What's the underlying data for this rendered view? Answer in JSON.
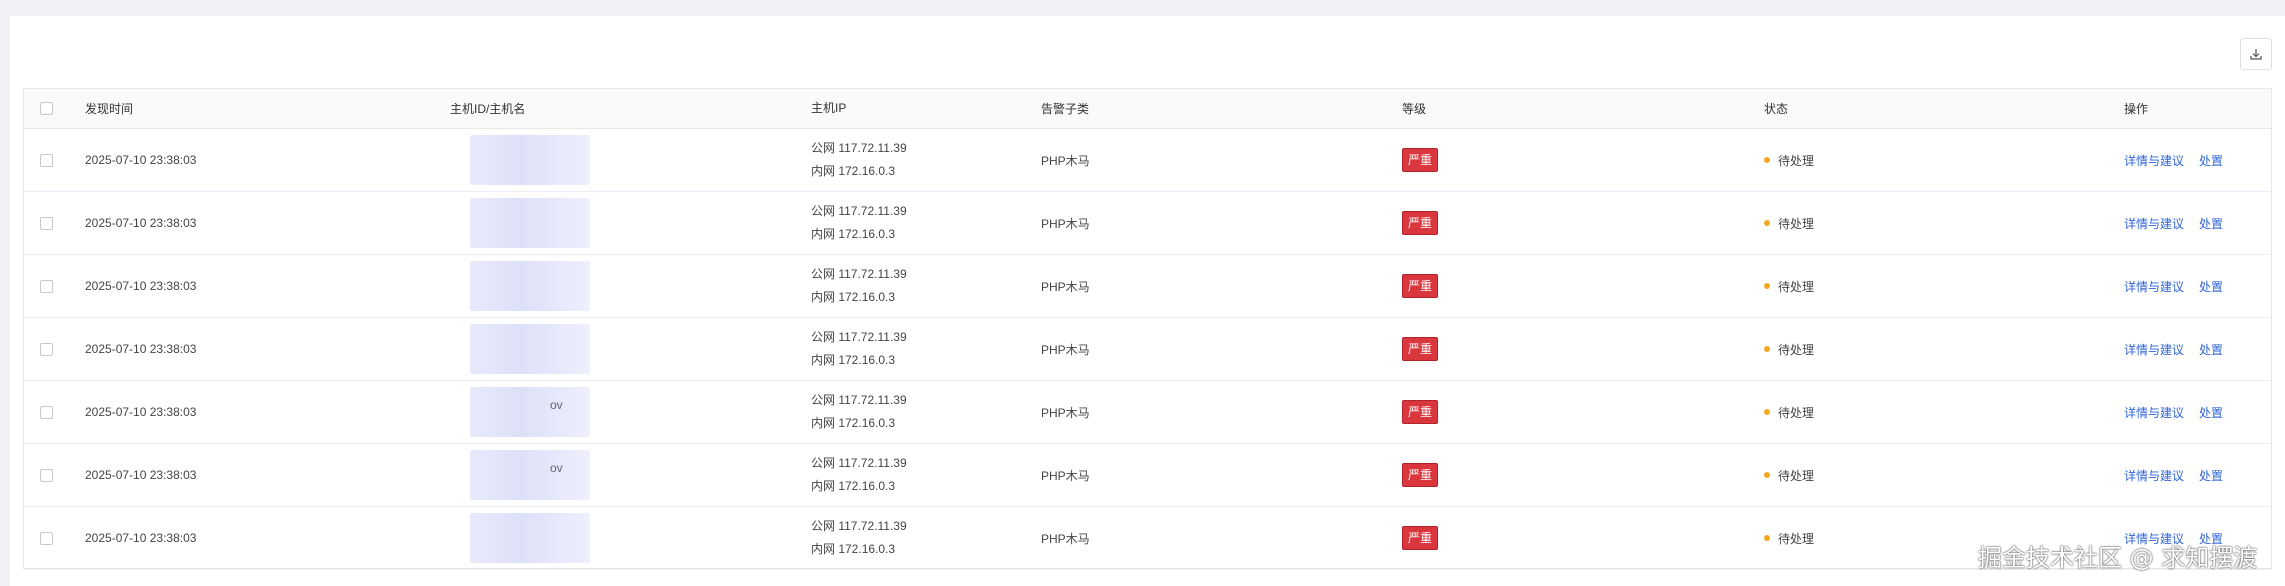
{
  "toolbar": {
    "download_icon": "download-icon"
  },
  "table": {
    "columns": {
      "time": "发现时间",
      "host": "主机ID/主机名",
      "ip": "主机IP",
      "subtype": "告警子类",
      "level": "等级",
      "status": "状态",
      "ops": "操作"
    },
    "rows": [
      {
        "time": "2025-07-10 23:38:03",
        "host": "",
        "public_ip": "公网 117.72.11.39",
        "private_ip": "内网 172.16.0.3",
        "subtype": "PHP木马",
        "level": "严重",
        "status": "待处理",
        "detail": "详情与建议",
        "handle": "处置"
      },
      {
        "time": "2025-07-10 23:38:03",
        "host": "",
        "public_ip": "公网 117.72.11.39",
        "private_ip": "内网 172.16.0.3",
        "subtype": "PHP木马",
        "level": "严重",
        "status": "待处理",
        "detail": "详情与建议",
        "handle": "处置"
      },
      {
        "time": "2025-07-10 23:38:03",
        "host": "",
        "public_ip": "公网 117.72.11.39",
        "private_ip": "内网 172.16.0.3",
        "subtype": "PHP木马",
        "level": "严重",
        "status": "待处理",
        "detail": "详情与建议",
        "handle": "处置"
      },
      {
        "time": "2025-07-10 23:38:03",
        "host": "",
        "public_ip": "公网 117.72.11.39",
        "private_ip": "内网 172.16.0.3",
        "subtype": "PHP木马",
        "level": "严重",
        "status": "待处理",
        "detail": "详情与建议",
        "handle": "处置"
      },
      {
        "time": "2025-07-10 23:38:03",
        "host": "ov",
        "public_ip": "公网 117.72.11.39",
        "private_ip": "内网 172.16.0.3",
        "subtype": "PHP木马",
        "level": "严重",
        "status": "待处理",
        "detail": "详情与建议",
        "handle": "处置"
      },
      {
        "time": "2025-07-10 23:38:03",
        "host": "ov",
        "public_ip": "公网 117.72.11.39",
        "private_ip": "内网 172.16.0.3",
        "subtype": "PHP木马",
        "level": "严重",
        "status": "待处理",
        "detail": "详情与建议",
        "handle": "处置"
      },
      {
        "time": "2025-07-10 23:38:03",
        "host": "",
        "public_ip": "公网 117.72.11.39",
        "private_ip": "内网 172.16.0.3",
        "subtype": "PHP木马",
        "level": "严重",
        "status": "待处理",
        "detail": "详情与建议",
        "handle": "处置"
      }
    ]
  },
  "colors": {
    "danger": "#d9363e",
    "pending_dot": "#f5a623",
    "link": "#3064d8"
  },
  "watermark": "掘金技术社区 @ 求知摆渡"
}
